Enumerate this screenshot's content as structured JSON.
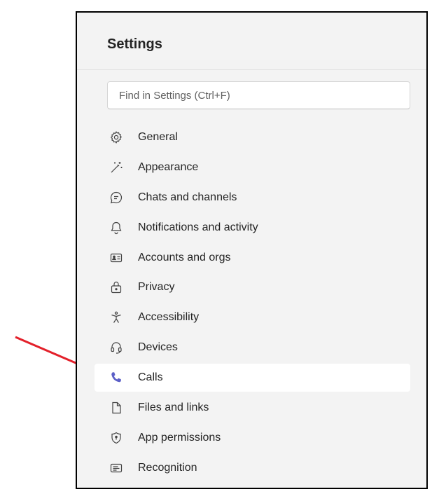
{
  "header": {
    "title": "Settings"
  },
  "search": {
    "placeholder": "Find in Settings (Ctrl+F)"
  },
  "menu": {
    "items": [
      {
        "label": "General",
        "icon": "gear-icon"
      },
      {
        "label": "Appearance",
        "icon": "magic-wand-icon"
      },
      {
        "label": "Chats and channels",
        "icon": "chat-icon"
      },
      {
        "label": "Notifications and activity",
        "icon": "bell-icon"
      },
      {
        "label": "Accounts and orgs",
        "icon": "contact-card-icon"
      },
      {
        "label": "Privacy",
        "icon": "lock-icon"
      },
      {
        "label": "Accessibility",
        "icon": "accessibility-icon"
      },
      {
        "label": "Devices",
        "icon": "headset-icon"
      },
      {
        "label": "Calls",
        "icon": "phone-icon",
        "selected": true
      },
      {
        "label": "Files and links",
        "icon": "document-icon"
      },
      {
        "label": "App permissions",
        "icon": "shield-icon"
      },
      {
        "label": "Recognition",
        "icon": "recognition-icon"
      }
    ]
  },
  "colors": {
    "accent": "#5b5fc7",
    "annotation_arrow": "#e3202a",
    "panel_bg": "#f3f3f3"
  }
}
